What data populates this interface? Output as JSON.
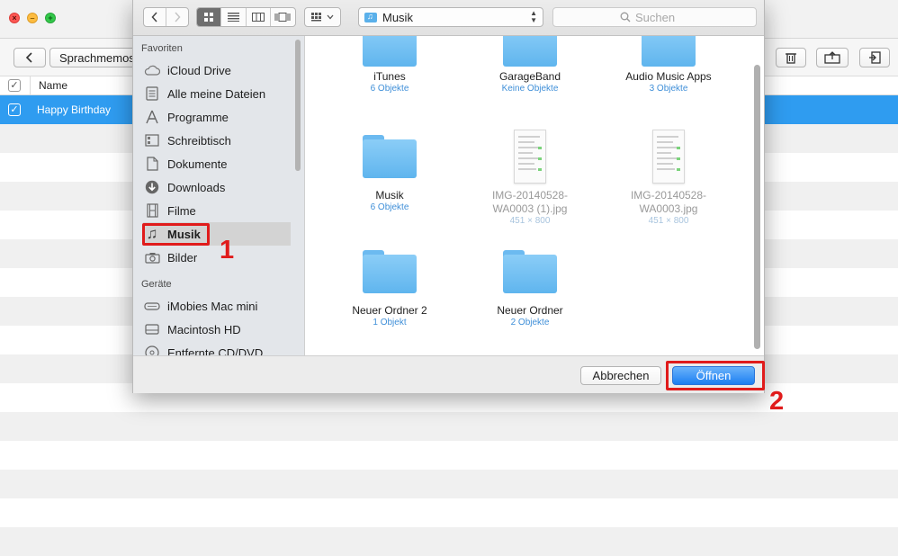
{
  "app": {
    "toolbar": {
      "breadcrumb_label": "Sprachmemos"
    },
    "list": {
      "column_name": "Name",
      "rows": [
        {
          "name": "Happy Birthday",
          "selected": true,
          "checked": true
        }
      ]
    }
  },
  "dialog": {
    "path_label": "Musik",
    "search_placeholder": "Suchen",
    "sidebar": {
      "favorites_heading": "Favoriten",
      "favorites": [
        {
          "label": "iCloud Drive",
          "icon": "cloud-icon"
        },
        {
          "label": "Alle meine Dateien",
          "icon": "all-files-icon"
        },
        {
          "label": "Programme",
          "icon": "applications-icon"
        },
        {
          "label": "Schreibtisch",
          "icon": "desktop-icon"
        },
        {
          "label": "Dokumente",
          "icon": "document-icon"
        },
        {
          "label": "Downloads",
          "icon": "download-icon"
        },
        {
          "label": "Filme",
          "icon": "film-icon"
        },
        {
          "label": "Musik",
          "icon": "music-note-icon",
          "selected": true
        },
        {
          "label": "Bilder",
          "icon": "camera-icon"
        }
      ],
      "devices_heading": "Geräte",
      "devices": [
        {
          "label": "iMobies Mac mini",
          "icon": "mac-mini-icon"
        },
        {
          "label": "Macintosh HD",
          "icon": "hard-drive-icon"
        },
        {
          "label": "Entfernte CD/DVD",
          "icon": "disc-icon"
        }
      ]
    },
    "files": [
      {
        "name": "iTunes",
        "sub": "6 Objekte",
        "kind": "folder"
      },
      {
        "name": "GarageBand",
        "sub": "Keine Objekte",
        "kind": "folder"
      },
      {
        "name": "Audio Music Apps",
        "sub": "3 Objekte",
        "kind": "folder"
      },
      {
        "name": "Musik",
        "sub": "6 Objekte",
        "kind": "folder"
      },
      {
        "name_line1": "IMG-20140528-",
        "name_line2": "WA0003 (1).jpg",
        "sub": "451 × 800",
        "kind": "image"
      },
      {
        "name_line1": "IMG-20140528-",
        "name_line2": "WA0003.jpg",
        "sub": "451 × 800",
        "kind": "image"
      },
      {
        "name": "Neuer Ordner 2",
        "sub": "1 Objekt",
        "kind": "folder"
      },
      {
        "name": "Neuer Ordner",
        "sub": "2 Objekte",
        "kind": "folder"
      }
    ],
    "buttons": {
      "cancel": "Abbrechen",
      "open": "Öffnen"
    }
  },
  "annotations": {
    "step1": "1",
    "step2": "2",
    "color": "#e01b1b"
  },
  "colors": {
    "selection_blue": "#2f9cf0",
    "folder_blue": "#6cbaf0",
    "primary_button": "#1c7ff2"
  }
}
